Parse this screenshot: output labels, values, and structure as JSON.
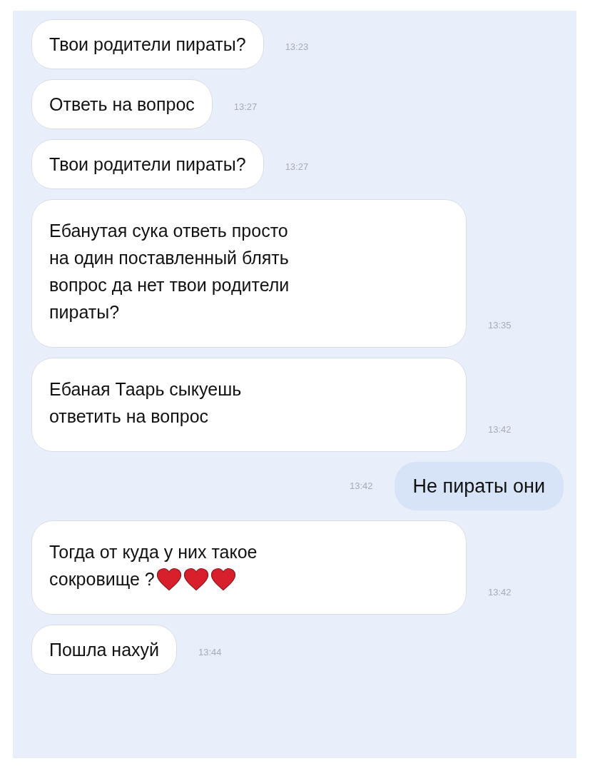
{
  "messages": [
    {
      "kind": "incoming",
      "text": "Твои родители пираты?",
      "time": "13:23"
    },
    {
      "kind": "incoming",
      "text": "Ответь на вопрос",
      "time": "13:27"
    },
    {
      "kind": "incoming",
      "text": "Твои родители пираты?",
      "time": "13:27"
    },
    {
      "kind": "incoming",
      "text": "Ебанутая сука ответь просто\nна один поставленный блять\nвопрос да нет твои родители\nпираты?",
      "time": "13:35"
    },
    {
      "kind": "incoming",
      "text": "Ебаная Таарь сыкуешь\nответить на вопрос",
      "time": "13:42"
    },
    {
      "kind": "outgoing",
      "text": "Не пираты они",
      "time": "13:42"
    },
    {
      "kind": "incoming",
      "text": "Тогда от куда у них такое\nсокровище ?",
      "emoji": [
        {
          "kind": "heart"
        },
        {
          "kind": "heart"
        },
        {
          "kind": "heart"
        }
      ],
      "time": "13:42"
    },
    {
      "kind": "incoming",
      "text": "Пошла нахуй",
      "time": "13:44"
    }
  ]
}
